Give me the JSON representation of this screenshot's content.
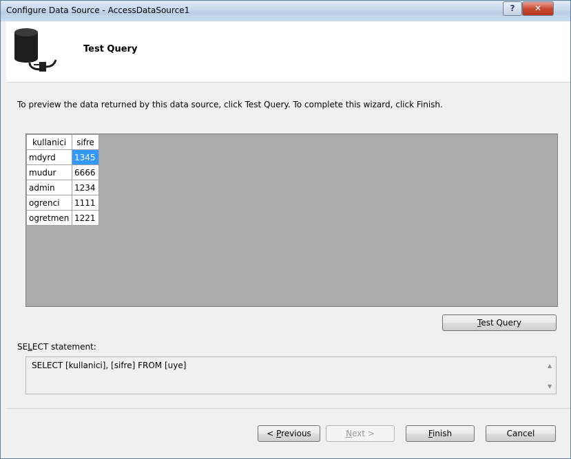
{
  "window": {
    "title": "Configure Data Source - AccessDataSource1"
  },
  "header": {
    "title": "Test Query"
  },
  "instructions": "To preview the data returned by this data source, click Test Query. To complete this wizard, click Finish.",
  "grid": {
    "columns": [
      "kullanici",
      "sifre"
    ],
    "rows": [
      [
        "mdyrd",
        "1345"
      ],
      [
        "mudur",
        "6666"
      ],
      [
        "admin",
        "1234"
      ],
      [
        "ogrenci",
        "1111"
      ],
      [
        "ogretmen",
        "1221"
      ]
    ]
  },
  "buttons": {
    "test_query_pre": "",
    "test_query_key": "T",
    "test_query_post": "est Query",
    "previous_pre": "< ",
    "previous_key": "P",
    "previous_post": "revious",
    "next_key": "N",
    "next_post": "ext >",
    "finish_key": "F",
    "finish_post": "inish",
    "cancel": "Cancel"
  },
  "select_label": {
    "pre": "SE",
    "key": "L",
    "post": "ECT statement:"
  },
  "sql": "SELECT [kullanici], [sifre] FROM [uye]",
  "colors": {
    "selection": "#3399ff",
    "grid_bg": "#ababab"
  }
}
